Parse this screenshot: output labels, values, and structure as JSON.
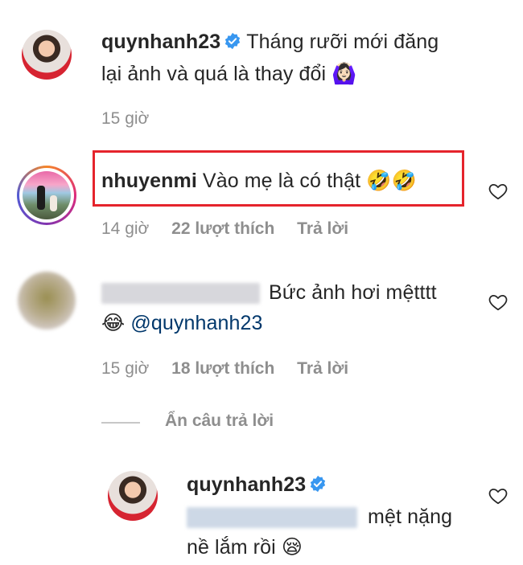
{
  "comments": [
    {
      "username": "quynhanh23",
      "verified": true,
      "text_line1": "Tháng rưỡi mới đăng",
      "text_line2": "lại ảnh và quá là thay đổi",
      "emoji": "🙆🏻‍♀️",
      "time": "15 giờ"
    },
    {
      "username": "nhuyenmi",
      "text": "Vào mẹ là có thật",
      "emoji": "🤣🤣",
      "time": "14 giờ",
      "likes": "22 lượt thích",
      "reply": "Trả lời",
      "highlighted": true
    },
    {
      "username_hidden": true,
      "text_line1": "Bức ảnh hơi mệtttt",
      "emoji": "😂",
      "mention": "@quynhanh23",
      "time": "15 giờ",
      "likes": "18 lượt thích",
      "reply": "Trả lời"
    }
  ],
  "hide_replies_label": "Ẩn câu trả lời",
  "reply": {
    "username": "quynhanh23",
    "verified": true,
    "text_line1_tail": "mệt nặng",
    "text_line2": "nề lắm rồi",
    "emoji": "😪"
  },
  "colors": {
    "text": "#262626",
    "meta": "#8e8e8e",
    "verified_blue": "#3897f0",
    "highlight_red": "#e5242c",
    "mention_blue": "#00376b"
  },
  "icons": [
    "verified-badge-icon",
    "heart-icon"
  ]
}
